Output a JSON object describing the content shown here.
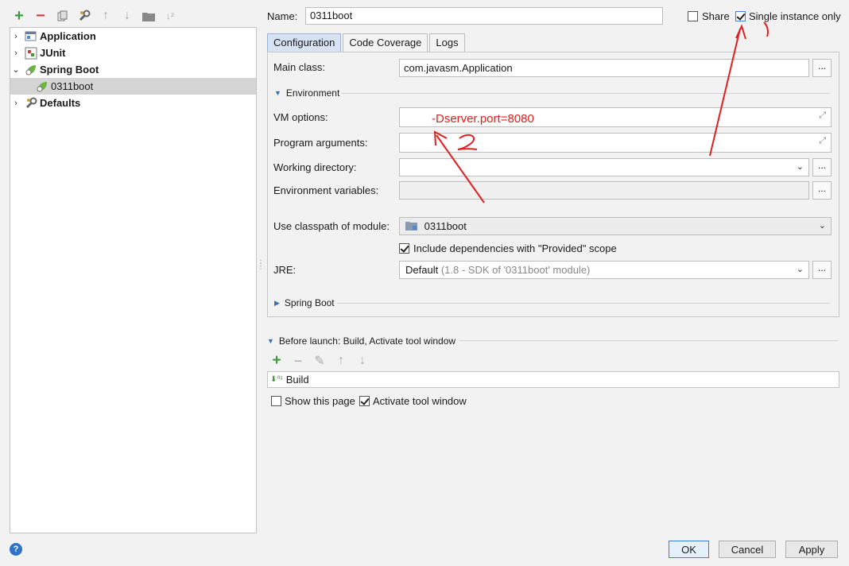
{
  "toolbar": {
    "icons": [
      "plus-icon",
      "minus-icon",
      "copy-icon",
      "wrench-icon",
      "arrow-up-icon",
      "arrow-down-icon",
      "folder-icon",
      "sort-icon"
    ]
  },
  "tree": {
    "items": [
      {
        "label": "Application",
        "expanded": false,
        "bold": true,
        "icon": "application-icon"
      },
      {
        "label": "JUnit",
        "expanded": false,
        "bold": true,
        "icon": "junit-icon"
      },
      {
        "label": "Spring Boot",
        "expanded": true,
        "bold": true,
        "icon": "spring-boot-icon"
      },
      {
        "label": "0311boot",
        "child": true,
        "selected": true,
        "icon": "spring-boot-config-icon"
      },
      {
        "label": "Defaults",
        "expanded": false,
        "bold": true,
        "icon": "defaults-icon"
      }
    ]
  },
  "header": {
    "name_label": "Name:",
    "name_value": "0311boot",
    "share_label": "Share",
    "share_checked": false,
    "single_instance_label": "Single instance only",
    "single_instance_checked": true
  },
  "tabs": [
    {
      "label": "Configuration",
      "active": true
    },
    {
      "label": "Code Coverage",
      "active": false
    },
    {
      "label": "Logs",
      "active": false
    }
  ],
  "config": {
    "main_class_label": "Main class:",
    "main_class_value": "com.javasm.Application",
    "environment_label": "Environment",
    "vm_options_label": "VM options:",
    "vm_options_value": "-Dserver.port=8080",
    "program_args_label": "Program arguments:",
    "program_args_value": "",
    "working_dir_label": "Working directory:",
    "working_dir_value": "",
    "env_vars_label": "Environment variables:",
    "env_vars_value": "",
    "classpath_label": "Use classpath of module:",
    "classpath_value": "0311boot",
    "include_deps_label": "Include dependencies with \"Provided\" scope",
    "include_deps_checked": true,
    "jre_label": "JRE:",
    "jre_value": "Default",
    "jre_detail": "(1.8 - SDK of '0311boot' module)",
    "spring_boot_label": "Spring Boot",
    "dots": "..."
  },
  "before_launch": {
    "label": "Before launch: Build, Activate tool window",
    "toolbar_icons": [
      "plus-icon",
      "minus-icon",
      "edit-icon",
      "arrow-up-icon",
      "arrow-down-icon"
    ],
    "items": [
      "Build"
    ],
    "show_page_label": "Show this page",
    "show_page_checked": false,
    "activate_label": "Activate tool window",
    "activate_checked": true
  },
  "footer": {
    "help": "?",
    "ok": "OK",
    "cancel": "Cancel",
    "apply": "Apply"
  },
  "annotations": {
    "mark_1": "1",
    "mark_2": "2",
    "color": "#e02020"
  },
  "colors": {
    "accent": "#3c7fd6",
    "add_green": "#3d9a3d",
    "remove_red": "#d04040",
    "selection": "#d5d5d5"
  }
}
